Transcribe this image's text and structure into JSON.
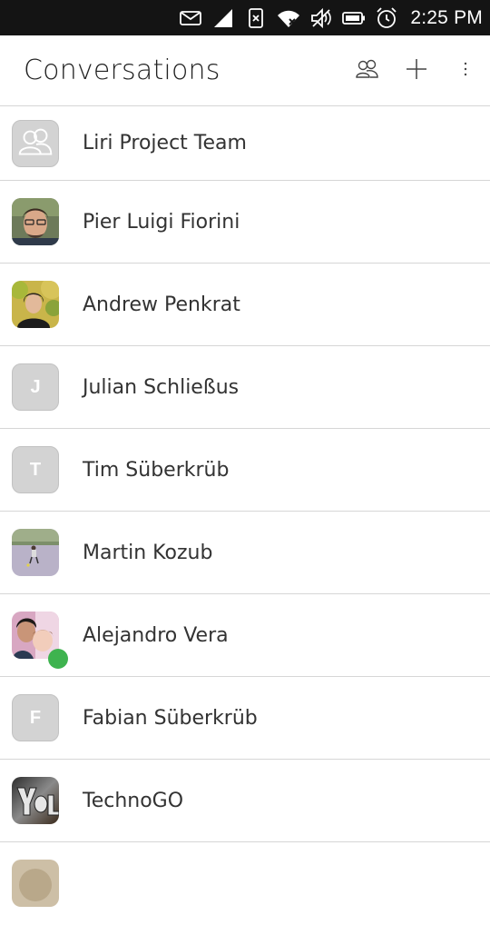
{
  "status_bar": {
    "time": "2:25 PM",
    "icons": [
      "mail-icon",
      "signal-icon",
      "no-sim-icon",
      "wifi-icon",
      "volume-muted-icon",
      "battery-icon",
      "alarm-icon"
    ]
  },
  "header": {
    "title": "Conversations",
    "actions": [
      "contacts-icon",
      "add-icon",
      "overflow-menu-icon"
    ]
  },
  "conversations": [
    {
      "name": "Liri Project Team",
      "avatar": "group-icon"
    },
    {
      "name": "Pier Luigi Fiorini",
      "avatar": "photo"
    },
    {
      "name": "Andrew Penkrat",
      "avatar": "photo"
    },
    {
      "name": "Julian Schließus",
      "avatar": "letter",
      "initial": "J"
    },
    {
      "name": "Tim Süberkrüb",
      "avatar": "letter",
      "initial": "T"
    },
    {
      "name": "Martin Kozub",
      "avatar": "photo"
    },
    {
      "name": "Alejandro Vera",
      "avatar": "photo",
      "online": true
    },
    {
      "name": "Fabian Süberkrüb",
      "avatar": "letter",
      "initial": "F"
    },
    {
      "name": "TechnoGO",
      "avatar": "photo"
    }
  ],
  "colors": {
    "status_bar_bg": "#141414",
    "divider": "#d6d6d6",
    "letter_avatar_bg": "#d3d3d3",
    "presence_online": "#3eb34f"
  }
}
